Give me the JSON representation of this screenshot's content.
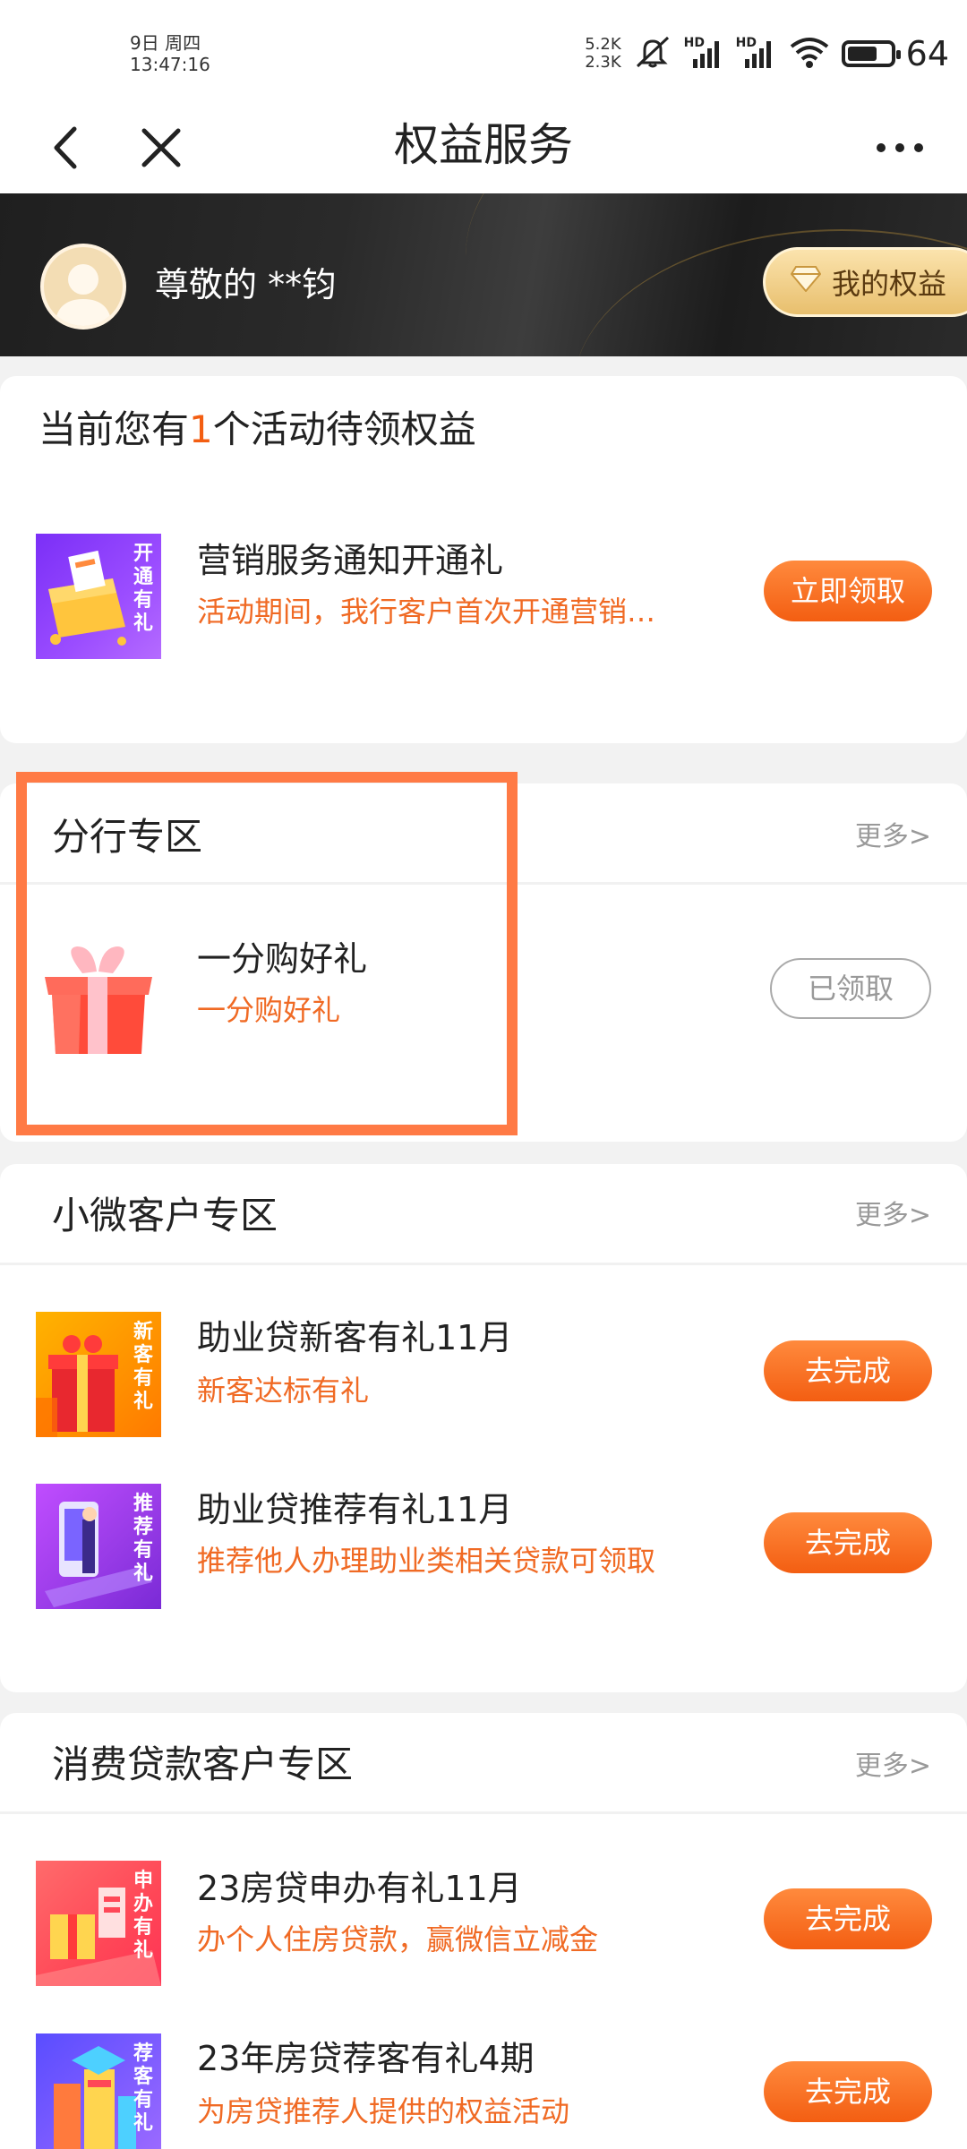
{
  "status_bar": {
    "date": "9日 周四",
    "time": "13:47:16",
    "net_up": "5.2K",
    "net_down": "2.3K",
    "hd1": "HD",
    "hd2": "HD",
    "battery": "64",
    "icons": [
      "mute-icon",
      "signal-icon",
      "signal-icon",
      "wifi-icon",
      "battery-icon"
    ]
  },
  "nav": {
    "title": "权益服务",
    "icons": [
      "back-icon",
      "close-icon",
      "more-icon"
    ]
  },
  "banner": {
    "greeting": "尊敬的 **钧",
    "my_rights_label": "我的权益",
    "icons": [
      "avatar",
      "diamond-icon"
    ]
  },
  "pending": {
    "title_prefix": "当前您有",
    "count": "1",
    "title_suffix": "个活动待领权益",
    "items": [
      {
        "title": "营销服务通知开通礼",
        "subtitle": "活动期间，我行客户首次开通营销…",
        "thumb_text": "开通有礼",
        "button": "立即领取"
      }
    ]
  },
  "branch": {
    "title": "分行专区",
    "more": "更多>",
    "items": [
      {
        "title": "一分购好礼",
        "subtitle": "一分购好礼",
        "button": "已领取"
      }
    ]
  },
  "small_micro": {
    "title": "小微客户专区",
    "more": "更多>",
    "items": [
      {
        "title": "助业贷新客有礼11月",
        "subtitle": "新客达标有礼",
        "thumb_text": "新客有礼",
        "button": "去完成"
      },
      {
        "title": "助业贷推荐有礼11月",
        "subtitle": "推荐他人办理助业类相关贷款可领取",
        "thumb_text": "推荐有礼",
        "button": "去完成"
      }
    ]
  },
  "consumer": {
    "title": "消费贷款客户专区",
    "more": "更多>",
    "items": [
      {
        "title": "23房贷申办有礼11月",
        "subtitle": "办个人住房贷款，赢微信立减金",
        "thumb_text": "申办有礼",
        "button": "去完成"
      },
      {
        "title": "23年房贷荐客有礼4期",
        "subtitle": "为房贷推荐人提供的权益活动",
        "thumb_text": "荐客有礼",
        "button": "去完成"
      }
    ]
  },
  "colors": {
    "accent_orange": "#f35e12",
    "subtitle_orange": "#f06a24",
    "highlight_border": "#ff7a45",
    "banner_dark": "#262626",
    "gold": "#e8bf6d"
  }
}
